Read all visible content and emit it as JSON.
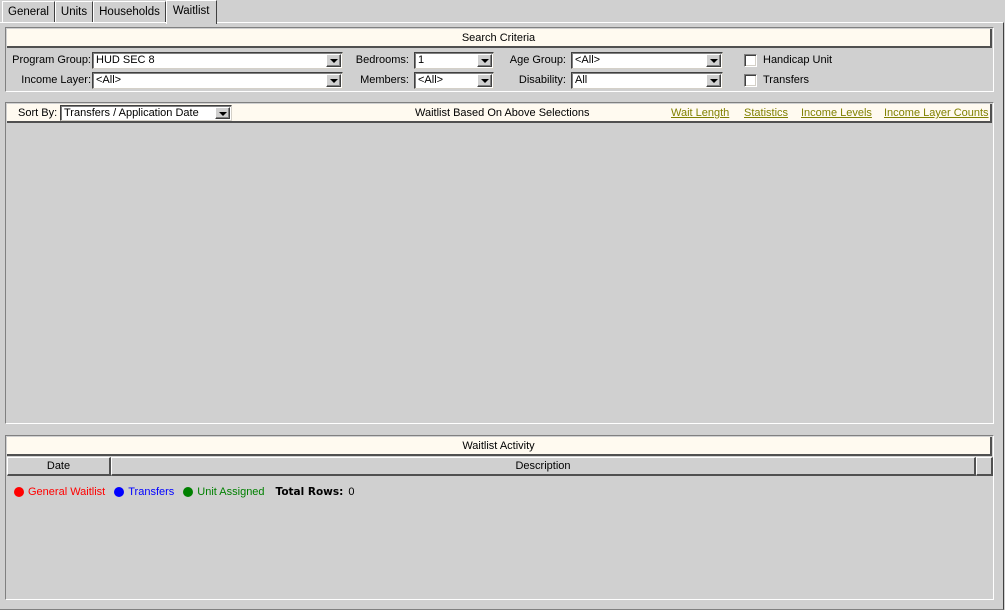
{
  "tabs": [
    {
      "label": "General",
      "active": false
    },
    {
      "label": "Units",
      "active": false
    },
    {
      "label": "Households",
      "active": false
    },
    {
      "label": "Waitlist",
      "active": true
    }
  ],
  "search_criteria": {
    "title": "Search Criteria",
    "program_group": {
      "label": "Program Group:",
      "value": "HUD SEC 8"
    },
    "income_layer": {
      "label": "Income Layer:",
      "value": "<All>"
    },
    "bedrooms": {
      "label": "Bedrooms:",
      "value": "1"
    },
    "members": {
      "label": "Members:",
      "value": "<All>"
    },
    "age_group": {
      "label": "Age Group:",
      "value": "<All>"
    },
    "disability": {
      "label": "Disability:",
      "value": "All"
    },
    "handicap_unit": {
      "label": "Handicap Unit",
      "checked": false
    },
    "transfers": {
      "label": "Transfers",
      "checked": false
    }
  },
  "waitlist": {
    "sort_by_label": "Sort By:",
    "sort_by_value": "Transfers / Application Date",
    "title": "Waitlist Based On Above Selections",
    "links": [
      "Wait Length",
      "Statistics",
      "Income Levels",
      "Income Layer Counts"
    ],
    "legend": [
      {
        "label": "General Waitlist",
        "color": "#ff0000"
      },
      {
        "label": "Transfers",
        "color": "#0000ff"
      },
      {
        "label": "Unit Assigned",
        "color": "#008000"
      }
    ],
    "total_rows_label": "Total Rows:",
    "total_rows_value": "0"
  },
  "activity": {
    "title": "Waitlist Activity",
    "columns": [
      "Date",
      "Description"
    ],
    "rows": []
  }
}
